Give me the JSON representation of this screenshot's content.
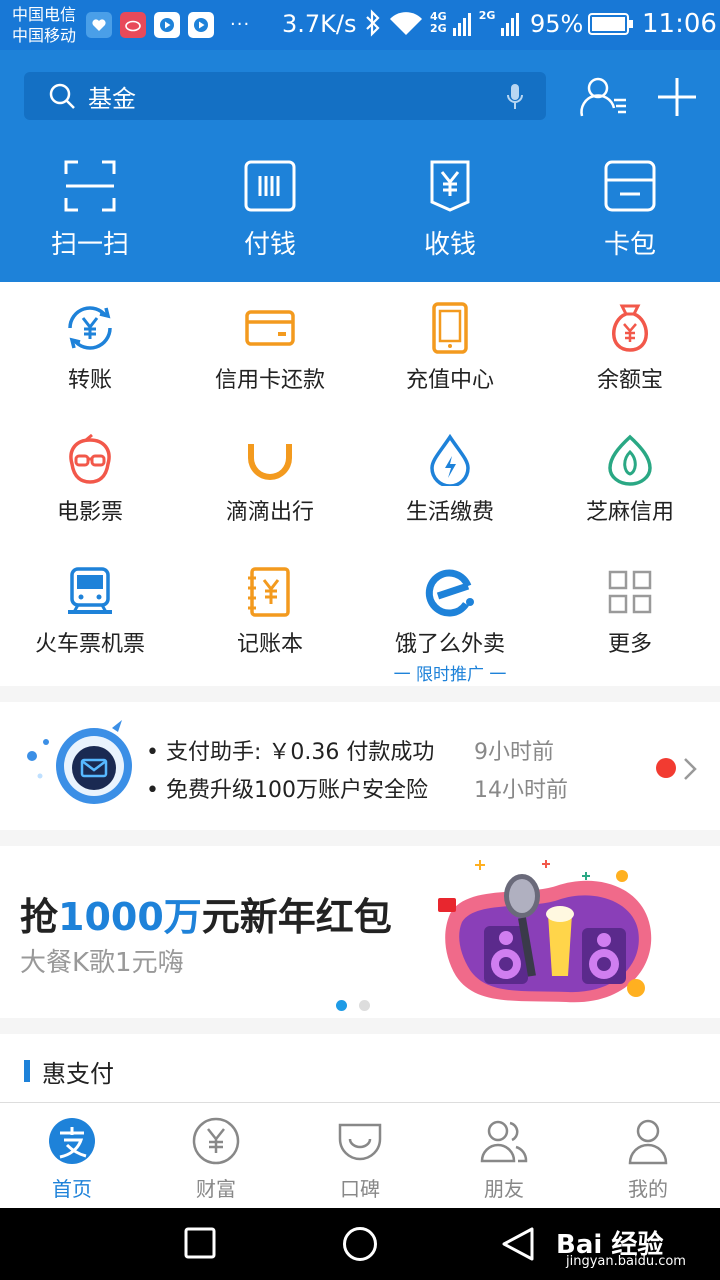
{
  "status_bar": {
    "carrier1": "中国电信",
    "carrier2": "中国移动",
    "more": "···",
    "speed": "3.7K/s",
    "net1": "4G",
    "net2": "2G",
    "net3": "2G",
    "battery": "95%",
    "time": "11:06"
  },
  "search": {
    "text": "基金"
  },
  "quick_actions": [
    {
      "label": "扫一扫",
      "icon": "scan-icon"
    },
    {
      "label": "付钱",
      "icon": "pay-code-icon"
    },
    {
      "label": "收钱",
      "icon": "receive-money-icon"
    },
    {
      "label": "卡包",
      "icon": "card-wallet-icon"
    }
  ],
  "services": [
    {
      "label": "转账",
      "icon": "transfer-icon",
      "color": "#1e82d9"
    },
    {
      "label": "信用卡还款",
      "icon": "credit-card-icon",
      "color": "#f39a1e"
    },
    {
      "label": "充值中心",
      "icon": "phone-recharge-icon",
      "color": "#f39a1e"
    },
    {
      "label": "余额宝",
      "icon": "money-bag-icon",
      "color": "#f2584a"
    },
    {
      "label": "电影票",
      "icon": "movie-ticket-icon",
      "color": "#f2584a"
    },
    {
      "label": "滴滴出行",
      "icon": "didi-icon",
      "color": "#f39a1e"
    },
    {
      "label": "生活缴费",
      "icon": "utility-drop-icon",
      "color": "#1e82d9"
    },
    {
      "label": "芝麻信用",
      "icon": "sesame-credit-icon",
      "color": "#2aa884"
    },
    {
      "label": "火车票机票",
      "icon": "train-icon",
      "color": "#1e82d9"
    },
    {
      "label": "记账本",
      "icon": "ledger-icon",
      "color": "#f39a1e"
    },
    {
      "label": "饿了么外卖",
      "icon": "eleme-icon",
      "color": "#1e82d9",
      "promo": "一 限时推广 一"
    },
    {
      "label": "更多",
      "icon": "more-grid-icon",
      "color": "#9a9a9a"
    }
  ],
  "notifications": [
    {
      "text": "• 支付助手: ￥0.36 付款成功",
      "time": "9小时前"
    },
    {
      "text": "• 免费升级100万账户安全险",
      "time": "14小时前"
    }
  ],
  "banner": {
    "title_prefix": "抢",
    "title_highlight": "1000万",
    "title_suffix": "元新年红包",
    "subtitle": "大餐K歌1元嗨"
  },
  "section": {
    "title": "惠支付"
  },
  "tabs": [
    {
      "label": "首页",
      "icon": "home-alipay-icon",
      "active": true
    },
    {
      "label": "财富",
      "icon": "wealth-icon"
    },
    {
      "label": "口碑",
      "icon": "koubei-icon"
    },
    {
      "label": "朋友",
      "icon": "friends-icon"
    },
    {
      "label": "我的",
      "icon": "profile-icon"
    }
  ],
  "watermark": {
    "main": "Bai 经验",
    "sub": "jingyan.baidu.com"
  },
  "colors": {
    "primary": "#1e82d9",
    "orange": "#f39a1e",
    "red": "#f2584a",
    "green": "#2aa884"
  }
}
